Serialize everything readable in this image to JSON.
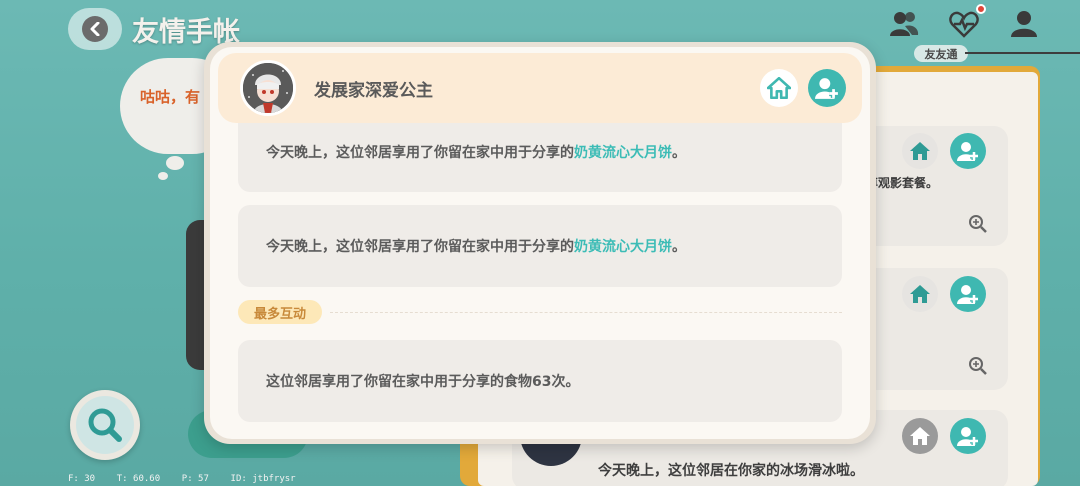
{
  "page": {
    "title": "友情手帐",
    "top_tab_label": "友友通",
    "thought_text": "咕咕，有",
    "debug_text": "F: 30    T: 60.60    P: 57    ID: jtbfrysr"
  },
  "background_list": {
    "item1_text": "尊观影套餐。",
    "item3_text": "今天晚上，这位邻居在你家的冰场滑冰啦。"
  },
  "modal": {
    "username": "发展家深爱公主",
    "messages": [
      {
        "prefix": "今天晚上，这位邻居享用了你留在家中用于分享的",
        "highlight": "奶黄流心大月饼",
        "suffix": "。"
      },
      {
        "prefix": "今天晚上，这位邻居享用了你留在家中用于分享的",
        "highlight": "奶黄流心大月饼",
        "suffix": "。"
      }
    ],
    "section_label": "最多互动",
    "most_interaction_text": "这位邻居享用了你留在家中用于分享的食物63次。"
  },
  "colors": {
    "accent_teal": "#3fb8b1",
    "highlight_text": "#3cbcb6",
    "header_bg": "#fcebd6",
    "section_tag_bg": "#fde8b8"
  },
  "icons": {
    "back": "chevron-left-icon",
    "friends": "people-icon",
    "pulse": "heartbeat-icon",
    "user": "user-icon",
    "home": "home-icon",
    "add_friend": "add-user-icon",
    "zoom": "zoom-in-icon",
    "search": "search-icon"
  }
}
